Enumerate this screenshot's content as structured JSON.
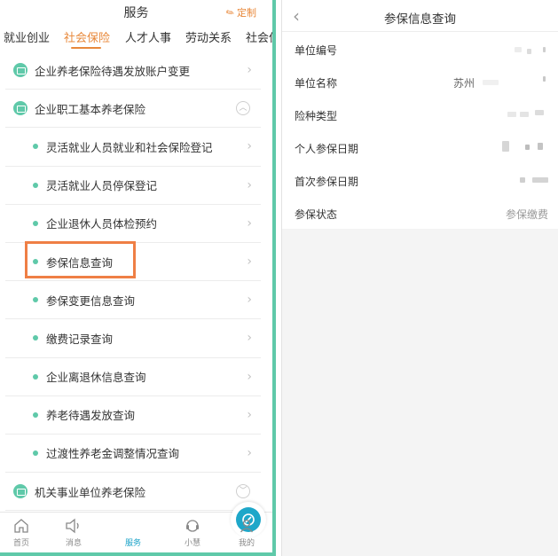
{
  "left": {
    "title": "服务",
    "custom_label": "定制",
    "tabs": [
      "就业创业",
      "社会保险",
      "人才人事",
      "劳动关系",
      "社会保"
    ],
    "items": [
      {
        "type": "category",
        "label": "企业养老保险待遇发放账户变更",
        "action": "chevron"
      },
      {
        "type": "category",
        "label": "企业职工基本养老保险",
        "action": "collapse"
      },
      {
        "type": "sub",
        "label": "灵活就业人员就业和社会保险登记"
      },
      {
        "type": "sub",
        "label": "灵活就业人员停保登记"
      },
      {
        "type": "sub",
        "label": "企业退休人员体检预约"
      },
      {
        "type": "sub",
        "label": "参保信息查询"
      },
      {
        "type": "sub",
        "label": "参保变更信息查询"
      },
      {
        "type": "sub",
        "label": "缴费记录查询"
      },
      {
        "type": "sub",
        "label": "企业离退休信息查询"
      },
      {
        "type": "sub",
        "label": "养老待遇发放查询"
      },
      {
        "type": "sub",
        "label": "过渡性养老金调整情况查询"
      },
      {
        "type": "category",
        "label": "机关事业单位养老保险",
        "action": "expand"
      }
    ],
    "nav": [
      "首页",
      "消息",
      "服务",
      "小慧",
      "我的"
    ],
    "colors": {
      "accent": "#e8883a",
      "green": "#5fc9a9",
      "nav_active": "#19a1c7",
      "highlight": "#ef7f45"
    }
  },
  "right": {
    "title": "参保信息查询",
    "rows": [
      {
        "key": "单位编号",
        "value": ""
      },
      {
        "key": "单位名称",
        "value": "苏州"
      },
      {
        "key": "险种类型",
        "value": ""
      },
      {
        "key": "个人参保日期",
        "value": ""
      },
      {
        "key": "首次参保日期",
        "value": ""
      },
      {
        "key": "参保状态",
        "value": "参保缴费"
      }
    ]
  }
}
